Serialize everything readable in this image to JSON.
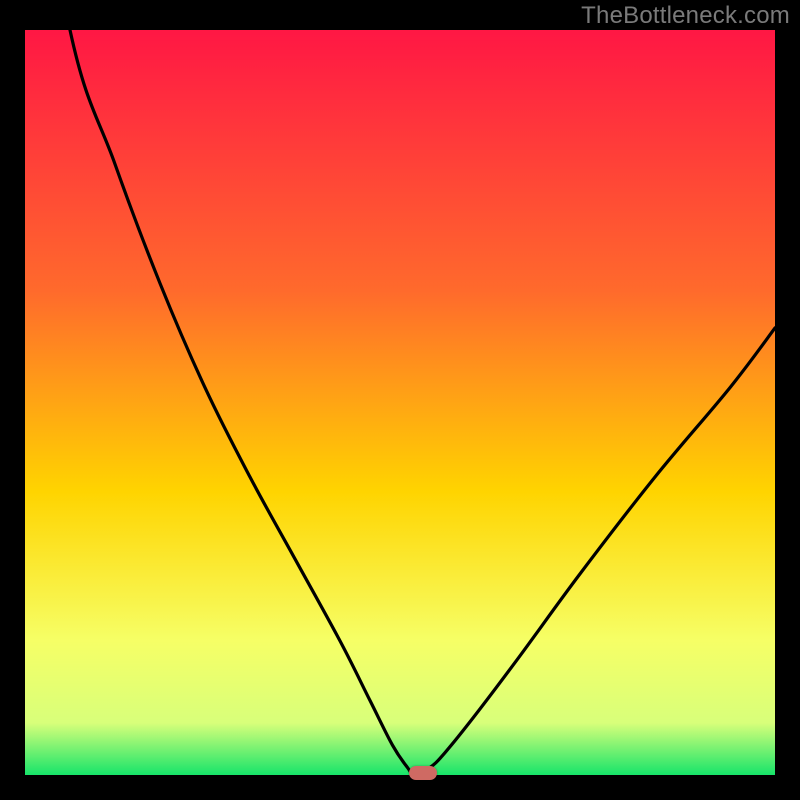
{
  "watermark": "TheBottleneck.com",
  "colors": {
    "frame": "#000000",
    "gradient_top": "#ff1744",
    "gradient_mid1": "#ff6a2c",
    "gradient_mid2": "#ffd400",
    "gradient_mid3": "#f6ff66",
    "gradient_bottom": "#17e46a",
    "curve": "#000000",
    "marker": "#cf6a63"
  },
  "chart_data": {
    "type": "line",
    "title": "",
    "xlabel": "",
    "ylabel": "",
    "xlim": [
      0,
      100
    ],
    "ylim": [
      0,
      100
    ],
    "grid": false,
    "legend": false,
    "annotations": [],
    "optimum_x": 52,
    "marker": {
      "x": 53,
      "y": 0,
      "color": "#cf6a63"
    },
    "series": [
      {
        "name": "bottleneck-curve",
        "x": [
          0,
          6,
          12,
          18,
          24,
          30,
          36,
          42,
          46,
          49,
          51,
          52,
          54,
          56,
          60,
          66,
          74,
          84,
          94,
          100
        ],
        "y": [
          138,
          100,
          82,
          66,
          52,
          40,
          29,
          18,
          10,
          4,
          1,
          0,
          1,
          3,
          8,
          16,
          27,
          40,
          52,
          60
        ]
      }
    ],
    "background_gradient": {
      "direction": "vertical",
      "stops": [
        {
          "pos": 0.0,
          "color": "#ff1744"
        },
        {
          "pos": 0.35,
          "color": "#ff6a2c"
        },
        {
          "pos": 0.62,
          "color": "#ffd400"
        },
        {
          "pos": 0.82,
          "color": "#f6ff66"
        },
        {
          "pos": 0.93,
          "color": "#d8ff7a"
        },
        {
          "pos": 1.0,
          "color": "#17e46a"
        }
      ]
    }
  }
}
